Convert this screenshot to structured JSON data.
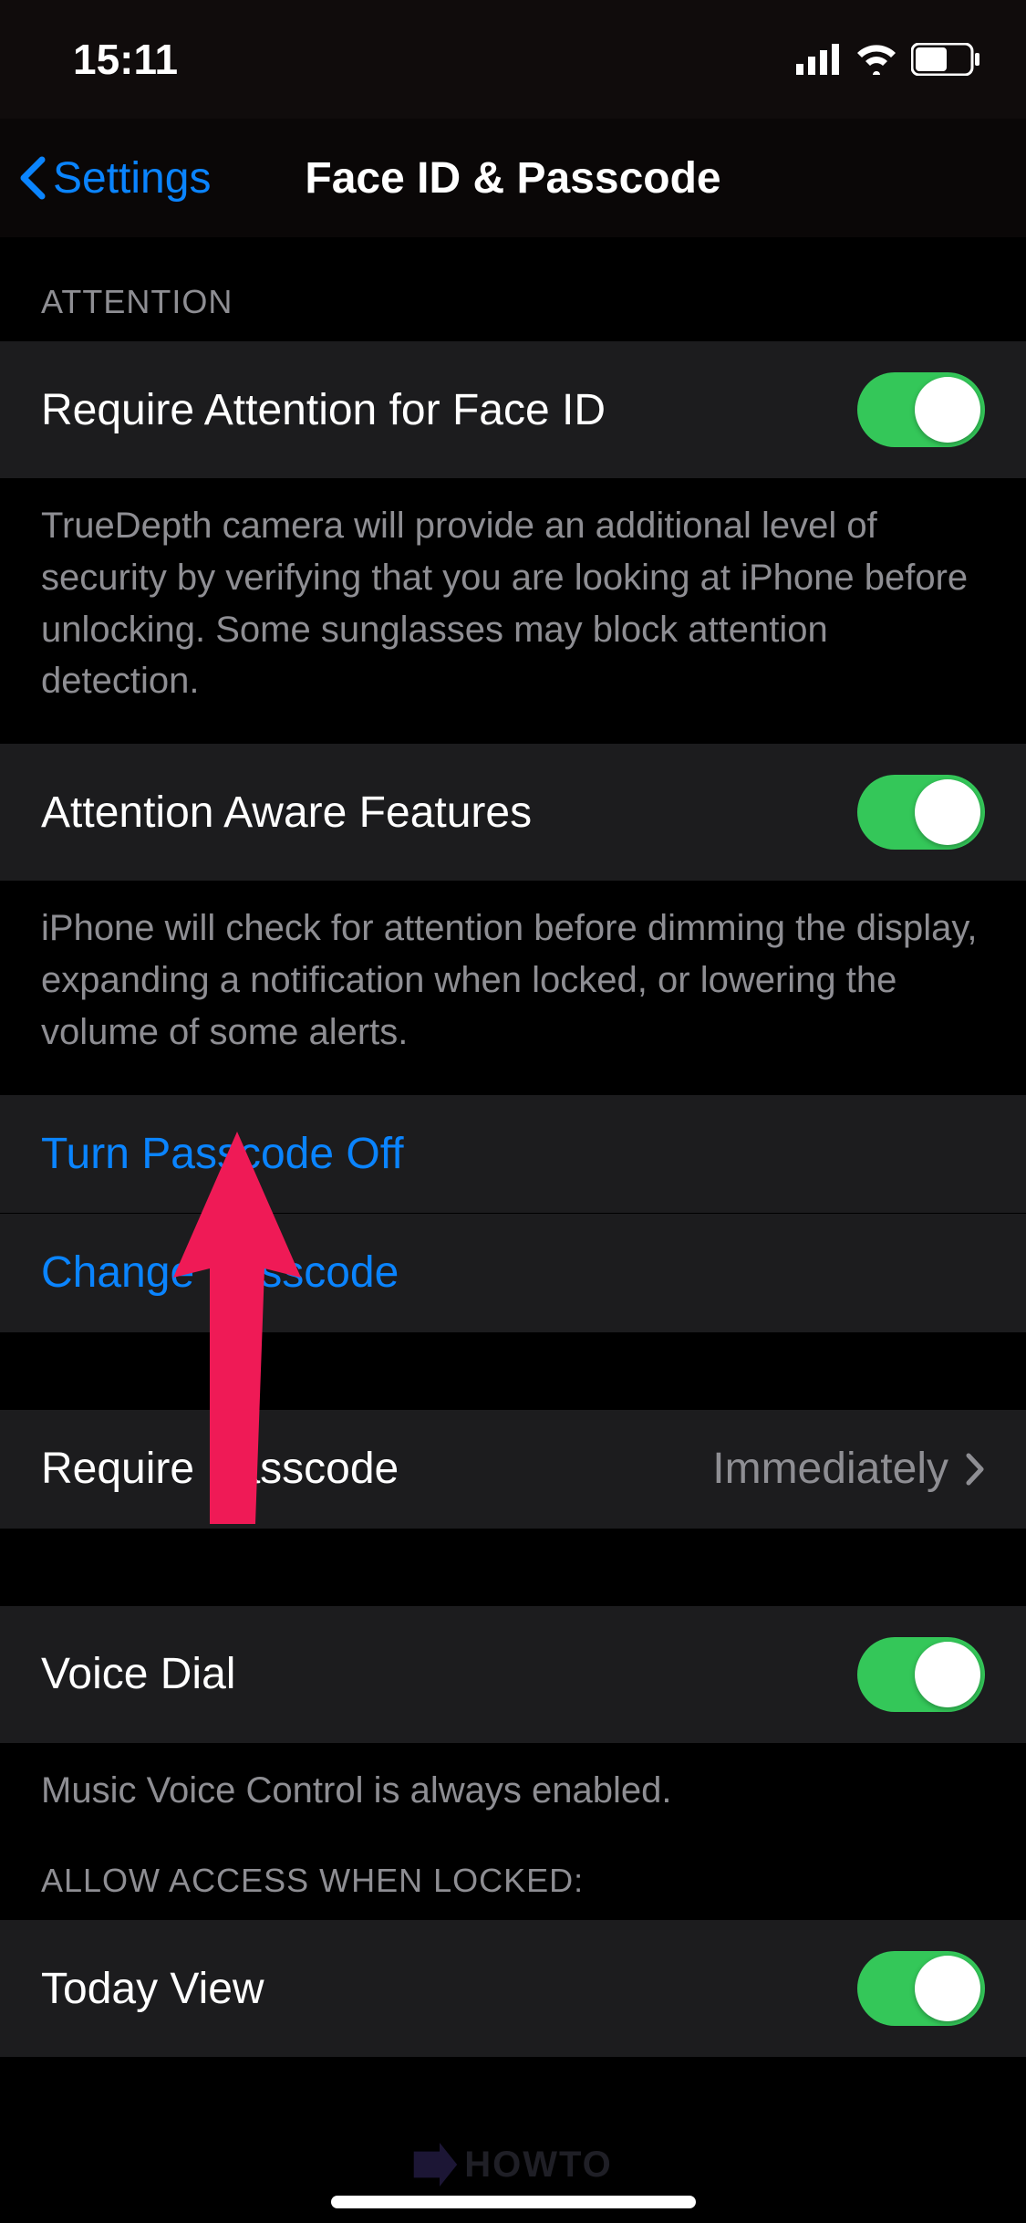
{
  "status": {
    "time": "15:11"
  },
  "nav": {
    "back": "Settings",
    "title": "Face ID & Passcode"
  },
  "sections": {
    "attention_header": "ATTENTION",
    "require_attention": {
      "label": "Require Attention for Face ID",
      "on": true
    },
    "require_attention_footer": "TrueDepth camera will provide an additional level of security by verifying that you are looking at iPhone before unlocking. Some sunglasses may block attention detection.",
    "attention_aware": {
      "label": "Attention Aware Features",
      "on": true
    },
    "attention_aware_footer": "iPhone will check for attention before dimming the display, expanding a notification when locked, or lowering the volume of some alerts.",
    "turn_passcode_off": "Turn Passcode Off",
    "change_passcode": "Change Passcode",
    "require_passcode": {
      "label": "Require Passcode",
      "value": "Immediately"
    },
    "voice_dial": {
      "label": "Voice Dial",
      "on": true
    },
    "voice_dial_footer": "Music Voice Control is always enabled.",
    "allow_access_header": "ALLOW ACCESS WHEN LOCKED:",
    "today_view": {
      "label": "Today View",
      "on": true
    }
  },
  "watermark": "HOWTO"
}
